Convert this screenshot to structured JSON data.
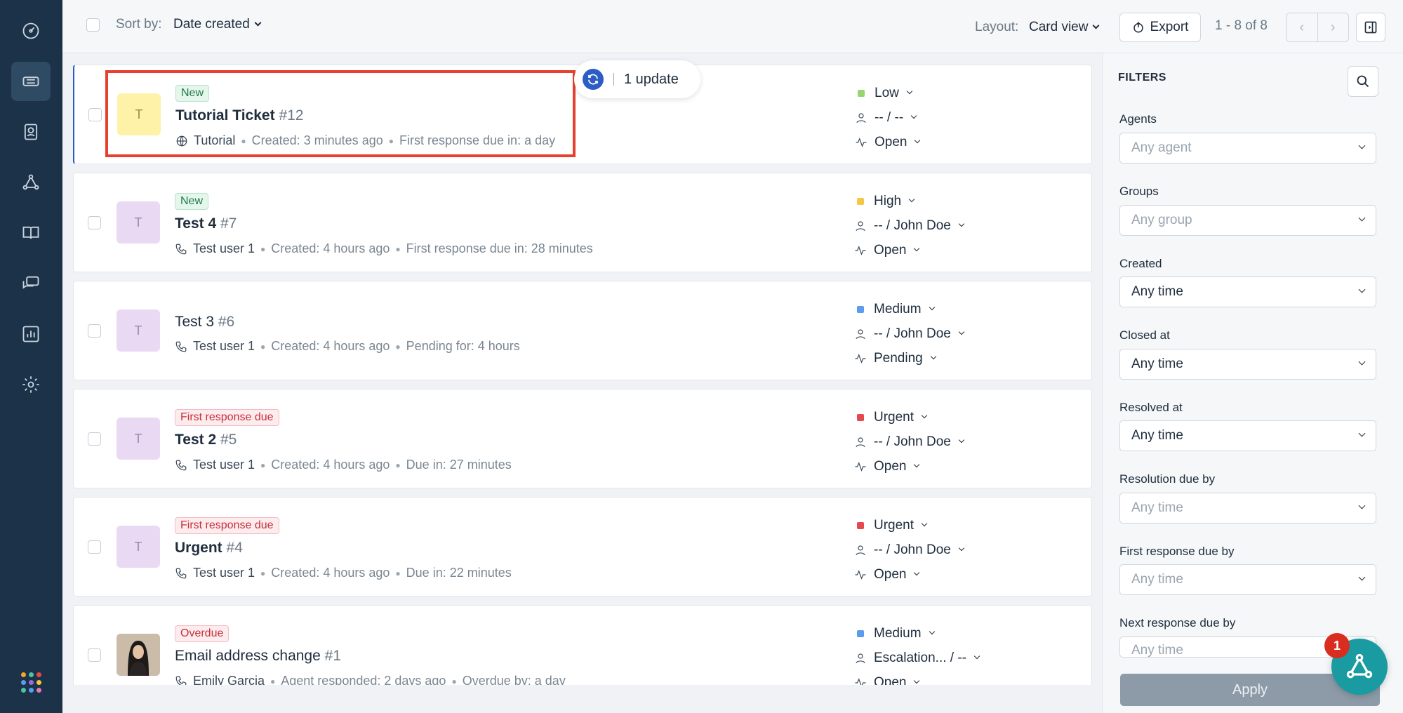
{
  "toolbar": {
    "sort_label": "Sort by:",
    "sort_value": "Date created",
    "layout_label": "Layout:",
    "layout_value": "Card view",
    "export_label": "Export",
    "page_count": "1 - 8 of 8",
    "prev_glyph": "‹",
    "next_glyph": "›"
  },
  "update_pill": {
    "label": "1 update"
  },
  "tickets": [
    {
      "badge": "New",
      "title": "Tutorial Ticket",
      "num": "#12",
      "source": "Tutorial",
      "created": "Created: 3 minutes ago",
      "due": "First response due in: a day",
      "priority": "Low",
      "assignee": "-- / --",
      "status": "Open",
      "avatar": "T"
    },
    {
      "badge": "New",
      "title": "Test 4",
      "num": "#7",
      "source": "Test user 1",
      "created": "Created: 4 hours ago",
      "due": "First response due in: 28 minutes",
      "priority": "High",
      "assignee": "-- / John Doe",
      "status": "Open",
      "avatar": "T"
    },
    {
      "badge": "",
      "title": "Test 3",
      "num": "#6",
      "source": "Test user 1",
      "created": "Created: 4 hours ago",
      "due": "Pending for: 4 hours",
      "priority": "Medium",
      "assignee": "-- / John Doe",
      "status": "Pending",
      "avatar": "T"
    },
    {
      "badge": "First response due",
      "title": "Test 2",
      "num": "#5",
      "source": "Test user 1",
      "created": "Created: 4 hours ago",
      "due": "Due in: 27 minutes",
      "priority": "Urgent",
      "assignee": "-- / John Doe",
      "status": "Open",
      "avatar": "T"
    },
    {
      "badge": "First response due",
      "title": "Urgent",
      "num": "#4",
      "source": "Test user 1",
      "created": "Created: 4 hours ago",
      "due": "Due in: 22 minutes",
      "priority": "Urgent",
      "assignee": "-- / John Doe",
      "status": "Open",
      "avatar": "T"
    },
    {
      "badge": "Overdue",
      "title": "Email address change",
      "num": "#1",
      "source": "Emily Garcia",
      "created": "Agent responded: 2 days ago",
      "due": "Overdue by: a day",
      "priority": "Medium",
      "assignee": "Escalation... / --",
      "status": "Open",
      "avatar": ""
    }
  ],
  "priority_colors": {
    "Low": "#9bd36f",
    "High": "#f6c744",
    "Medium": "#5b9bf0",
    "Urgent": "#e5484d"
  },
  "filters": {
    "title": "FILTERS",
    "agents_label": "Agents",
    "agents_value": "Any agent",
    "groups_label": "Groups",
    "groups_value": "Any group",
    "created_label": "Created",
    "created_value": "Any time",
    "closed_label": "Closed at",
    "closed_value": "Any time",
    "resolved_label": "Resolved at",
    "resolved_value": "Any time",
    "resolution_label": "Resolution due by",
    "resolution_value": "Any time",
    "first_response_label": "First response due by",
    "first_response_value": "Any time",
    "next_response_label": "Next response due by",
    "next_response_value": "Any time",
    "apply_label": "Apply"
  },
  "assistant": {
    "badge_count": "1"
  },
  "colors": {
    "nav_bg": "#1b3248",
    "accent": "#2c5cc5",
    "highlight": "#e8402e"
  }
}
